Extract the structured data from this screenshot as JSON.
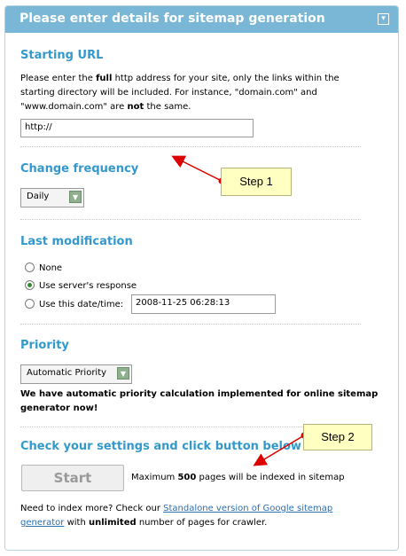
{
  "header": {
    "title": "Please enter details for sitemap generation",
    "icon": "collapse-icon"
  },
  "starting_url": {
    "heading": "Starting URL",
    "desc_1a": "Please enter the ",
    "desc_1b": "full",
    "desc_1c": " http address for your site, only the links within the",
    "desc_2": "starting directory will be included. For instance, \"domain.com\" and",
    "desc_3a": "\"www.domain.com\" are ",
    "desc_3b": "not",
    "desc_3c": " the same.",
    "value": "http://"
  },
  "change_frequency": {
    "heading": "Change frequency",
    "selected": "Daily"
  },
  "last_modification": {
    "heading": "Last modification",
    "options": [
      "None",
      "Use server's response",
      "Use this date/time:"
    ],
    "selected_index": 1,
    "datetime_value": "2008-11-25 06:28:13"
  },
  "priority": {
    "heading": "Priority",
    "selected": "Automatic Priority",
    "note_1": "We have automatic priority calculation implemented for online sitemap",
    "note_2": "generator now!"
  },
  "check": {
    "heading": "Check your settings and click button below",
    "start_label": "Start",
    "max_a": "Maximum ",
    "max_b": "500",
    "max_c": " pages will be indexed in sitemap"
  },
  "footer": {
    "line1_a": "Need to index more? Check our ",
    "link_1": "Standalone version of Google sitemap",
    "link_2": "generator",
    "line2_a": " with ",
    "line2_b": "unlimited",
    "line2_c": " number of pages for crawler."
  },
  "callouts": {
    "step1": "Step 1",
    "step2": "Step 2"
  },
  "colors": {
    "accent": "#3399cc",
    "header_bg": "#7ab6d6",
    "callout_bg": "#ffffc2",
    "arrow": "#dd0000"
  }
}
